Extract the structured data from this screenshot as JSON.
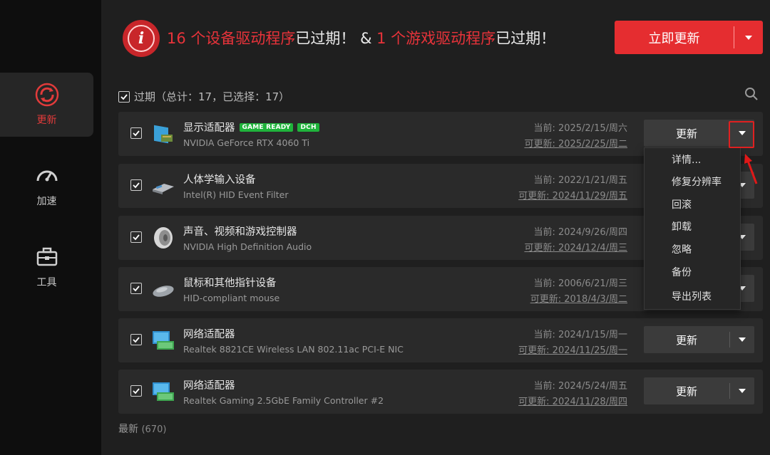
{
  "nav": [
    {
      "label": "更新",
      "icon": "update-icon",
      "active": true
    },
    {
      "label": "加速",
      "icon": "speedometer-icon",
      "active": false
    },
    {
      "label": "工具",
      "icon": "toolbox-icon",
      "active": false
    }
  ],
  "header": {
    "alert_glyph": "i",
    "part1_red": "16 个设备驱动程序",
    "part2": "已过期！ & ",
    "part3_red": "1 个游戏驱动程序",
    "part4": "已过期！",
    "update_all_label": "立即更新"
  },
  "section": {
    "label": "过期（总计：17，已选择：17）"
  },
  "drivers": [
    {
      "name": "显示适配器",
      "badges": [
        "GAME READY",
        "DCH"
      ],
      "model": "NVIDIA GeForce RTX 4060 Ti",
      "current": "当前: 2025/2/15/周六",
      "available": "可更新: 2025/2/25/周二",
      "icon": "display-adapter-icon"
    },
    {
      "name": "人体学输入设备",
      "badges": [],
      "model": "Intel(R) HID Event Filter",
      "current": "当前: 2022/1/21/周五",
      "available": "可更新: 2024/11/29/周五",
      "icon": "hid-device-icon"
    },
    {
      "name": "声音、视频和游戏控制器",
      "badges": [],
      "model": "NVIDIA High Definition Audio",
      "current": "当前: 2024/9/26/周四",
      "available": "可更新: 2024/12/4/周三",
      "icon": "speaker-icon"
    },
    {
      "name": "鼠标和其他指针设备",
      "badges": [],
      "model": "HID-compliant mouse",
      "current": "当前: 2006/6/21/周三",
      "available": "可更新: 2018/4/3/周二",
      "icon": "mouse-icon"
    },
    {
      "name": "网络适配器",
      "badges": [],
      "model": "Realtek 8821CE Wireless LAN 802.11ac PCI-E NIC",
      "current": "当前: 2024/1/15/周一",
      "available": "可更新: 2024/11/25/周一",
      "icon": "network-adapter-icon"
    },
    {
      "name": "网络适配器",
      "badges": [],
      "model": "Realtek Gaming 2.5GbE Family Controller #2",
      "current": "当前: 2024/5/24/周五",
      "available": "可更新: 2024/11/28/周四",
      "icon": "network-adapter-icon"
    }
  ],
  "row_button_label": "更新",
  "menu": [
    "详情...",
    "修复分辨率",
    "回滚",
    "卸载",
    "忽略",
    "备份",
    "导出列表"
  ],
  "footer": {
    "label": "最新",
    "count": "(670)"
  },
  "colors": {
    "accent": "#e52d30",
    "sidebar": "#0e0e0e",
    "row": "#2a2a2a",
    "badge": "#1fb33b"
  }
}
